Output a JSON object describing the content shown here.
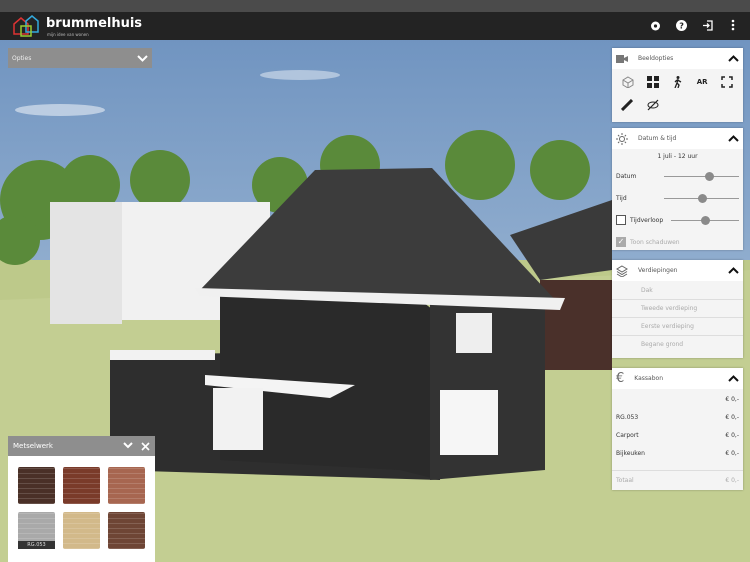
{
  "header": {
    "brand": "brummelhuis",
    "tagline": "mijn idee van wonen"
  },
  "options": {
    "label": "Opties"
  },
  "beeldopties": {
    "title": "Beeldopties",
    "ar_label": "AR"
  },
  "datum": {
    "title": "Datum & tijd",
    "current": "1 juli - 12 uur",
    "datum_label": "Datum",
    "datum_value": 0.6,
    "tijd_label": "Tijd",
    "tijd_value": 0.5,
    "tijdverloop_label": "Tijdverloop",
    "tijdverloop_value": 0.5,
    "tijdverloop_checked": false,
    "schaduwen_label": "Toon schaduwen",
    "schaduwen_checked": true
  },
  "verdiepingen": {
    "title": "Verdiepingen",
    "floors": [
      "Dak",
      "Tweede verdieping",
      "Eerste verdieping",
      "Begane grond"
    ]
  },
  "kassabon": {
    "title": "Kassabon",
    "lines": [
      {
        "label": "",
        "price": "€ 0,-"
      },
      {
        "label": "RG.053",
        "price": "€ 0,-"
      },
      {
        "label": "Carport",
        "price": "€ 0,-"
      },
      {
        "label": "Bijkeuken",
        "price": "€ 0,-"
      }
    ],
    "total_label": "Totaal",
    "total_price": "€ 0,-"
  },
  "metselwerk": {
    "title": "Metselwerk",
    "swatches": [
      {
        "color": "#4a3027",
        "label": ""
      },
      {
        "color": "#7a3b2a",
        "label": ""
      },
      {
        "color": "#a76650",
        "label": ""
      },
      {
        "color": "#a9a9a9",
        "label": "RG.053"
      },
      {
        "color": "#d2b98a",
        "label": ""
      },
      {
        "color": "#6e4535",
        "label": ""
      }
    ]
  }
}
